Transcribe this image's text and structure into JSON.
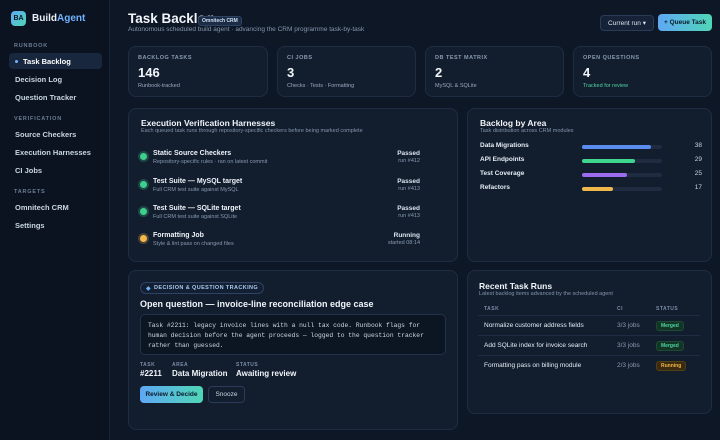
{
  "brand": {
    "logo": "BA",
    "name_a": "Build",
    "name_b": "Agent"
  },
  "sidebar": {
    "sections": [
      "RUNBOOK",
      "VERIFICATION",
      "TARGETS"
    ],
    "items": [
      {
        "label": "Task Backlog",
        "active": true
      },
      {
        "label": "Decision Log"
      },
      {
        "label": "Question Tracker"
      },
      {
        "label": "Source Checkers"
      },
      {
        "label": "Execution Harnesses"
      },
      {
        "label": "CI Jobs"
      },
      {
        "label": "Omnitech CRM"
      },
      {
        "label": "Settings"
      }
    ]
  },
  "header": {
    "title": "Task Backlog",
    "badge": "Omnitech CRM",
    "subtitle": "Autonomous scheduled build agent · advancing the CRM programme task-by-task",
    "run_button": "Current run ▾",
    "queue_button": "+ Queue Task"
  },
  "stats": [
    {
      "label": "BACKLOG TASKS",
      "value": "146",
      "sub": "Runbook-tracked"
    },
    {
      "label": "CI JOBS",
      "value": "3",
      "sub": "Checks · Tests · Formatting"
    },
    {
      "label": "DB TEST MATRIX",
      "value": "2",
      "sub": "MySQL & SQLite"
    },
    {
      "label": "OPEN QUESTIONS",
      "value": "4",
      "sub": "Tracked for review"
    }
  ],
  "harnesses": {
    "title": "Execution Verification Harnesses",
    "subtitle": "Each queued task runs through repository-specific checkers before being marked complete",
    "items": [
      {
        "name": "Static Source Checkers",
        "desc": "Repository-specific rules · ran on latest commit",
        "status": "Passed",
        "run": "run #412"
      },
      {
        "name": "Test Suite — MySQL target",
        "desc": "Full CRM test suite against MySQL",
        "status": "Passed",
        "run": "run #413"
      },
      {
        "name": "Test Suite — SQLite target",
        "desc": "Full CRM test suite against SQLite",
        "status": "Passed",
        "run": "run #413"
      },
      {
        "name": "Formatting Job",
        "desc": "Style & lint pass on changed files",
        "status": "Running",
        "run": "started 08:14"
      }
    ]
  },
  "areas": {
    "title": "Backlog by Area",
    "subtitle": "Task distribution across CRM modules",
    "max": 44,
    "items": [
      {
        "name": "Data Migrations",
        "count": 38,
        "color": "#5b8df0"
      },
      {
        "name": "API Endpoints",
        "count": 29,
        "color": "#3ed68e"
      },
      {
        "name": "Test Coverage",
        "count": 25,
        "color": "#9b6cf0"
      },
      {
        "name": "Refactors",
        "count": 17,
        "color": "#f0b84a"
      }
    ]
  },
  "question": {
    "pill": "DECISION & QUESTION TRACKING",
    "title": "Open question — invoice-line reconciliation edge case",
    "body": "Task #2211: legacy invoice lines with a null tax code. Runbook flags for human decision before the agent proceeds — logged to the question tracker rather than guessed.",
    "meta": [
      {
        "label": "TASK",
        "value": "#2211"
      },
      {
        "label": "AREA",
        "value": "Data Migration"
      },
      {
        "label": "STATUS",
        "value": "Awaiting review"
      }
    ],
    "review_button": "Review & Decide",
    "snooze_button": "Snooze"
  },
  "runs": {
    "title": "Recent Task Runs",
    "subtitle": "Latest backlog items advanced by the scheduled agent",
    "headers": [
      "TASK",
      "CI",
      "STATUS"
    ],
    "rows": [
      {
        "task": "Normalize customer address fields",
        "ci": "3/3 jobs",
        "status": "Merged"
      },
      {
        "task": "Add SQLite index for invoice search",
        "ci": "3/3 jobs",
        "status": "Merged"
      },
      {
        "task": "Formatting pass on billing module",
        "ci": "2/3 jobs",
        "status": "Running"
      }
    ]
  }
}
